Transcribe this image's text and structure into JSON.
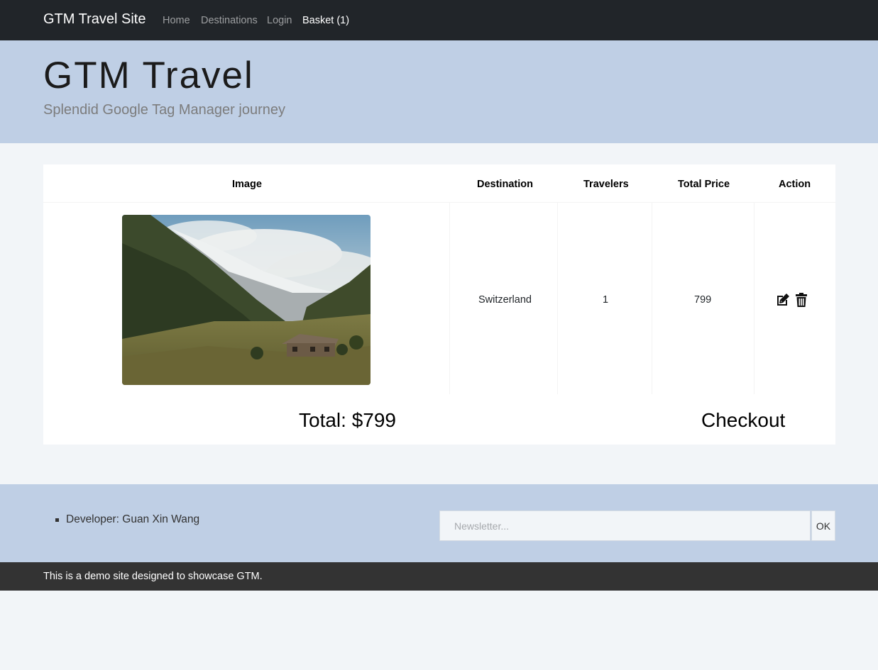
{
  "navbar": {
    "brand": "GTM Travel Site",
    "links": [
      {
        "label": "Home"
      },
      {
        "label": "Destinations"
      },
      {
        "label": "Login"
      },
      {
        "label": "Basket (1)"
      }
    ]
  },
  "hero": {
    "title": "GTM Travel",
    "subtitle": "Splendid Google Tag Manager journey"
  },
  "basket": {
    "headers": [
      "Image",
      "Destination",
      "Travelers",
      "Total Price",
      "Action"
    ],
    "rows": [
      {
        "image_icon": "mountain-valley-cabin-photo",
        "destination": "Switzerland",
        "travelers": "1",
        "total_price": "799",
        "actions": [
          "edit-icon",
          "trash-icon"
        ]
      }
    ],
    "total": "Total: $799",
    "checkout_label": "Checkout"
  },
  "footer": {
    "developer": "Developer: Guan Xin Wang",
    "newsletter_placeholder": "Newsletter...",
    "newsletter_value": "",
    "ok_label": "OK",
    "note": "This is a demo site designed to showcase GTM."
  },
  "colors": {
    "navbar_bg": "#212529",
    "hero_bg": "#bfcfe5",
    "page_bg": "#f2f5f8",
    "bottom_bar_bg": "#333333"
  }
}
